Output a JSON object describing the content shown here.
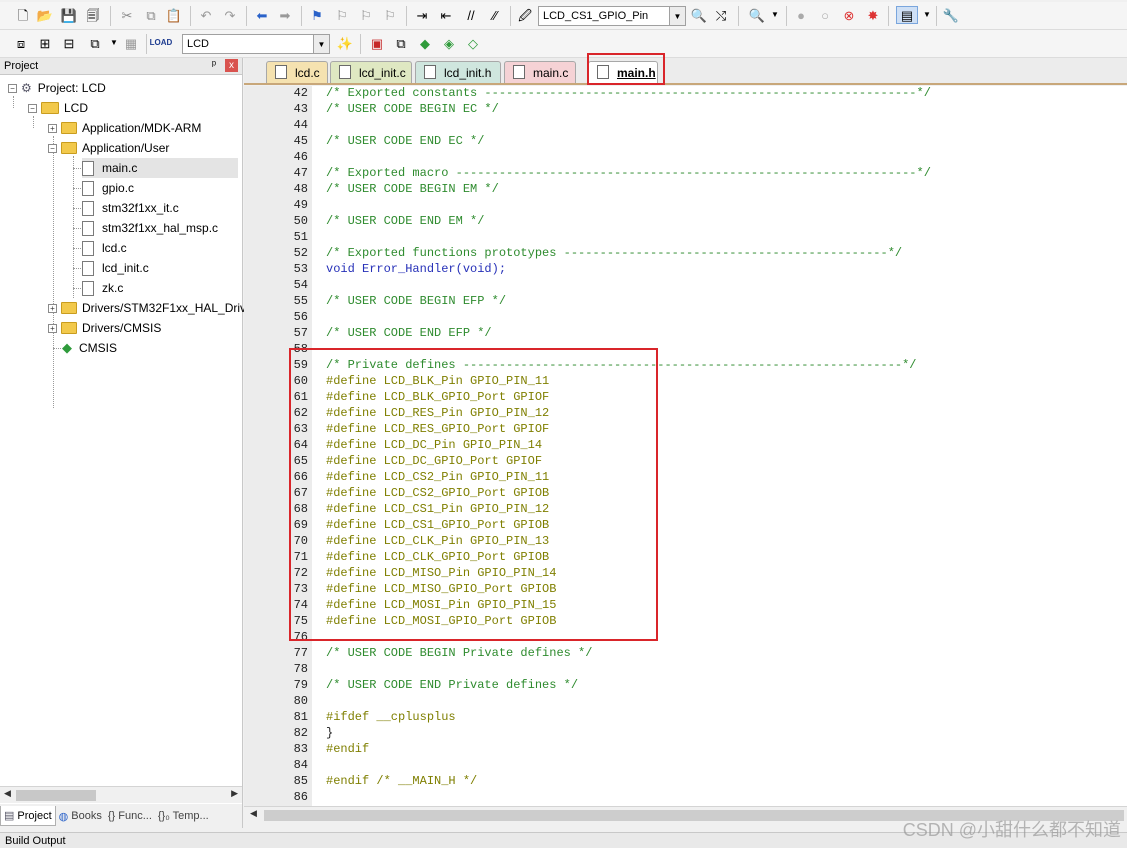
{
  "toolbar1": {
    "target_combo": "LCD_CS1_GPIO_Pin"
  },
  "toolbar2": {
    "target_combo": "LCD"
  },
  "project_panel": {
    "title": "Project",
    "pin": "ᵖ",
    "close": "x",
    "tree": {
      "root": "Project: LCD",
      "target": "LCD",
      "group1": "Application/MDK-ARM",
      "group2": "Application/User",
      "files": [
        "main.c",
        "gpio.c",
        "stm32f1xx_it.c",
        "stm32f1xx_hal_msp.c",
        "lcd.c",
        "lcd_init.c",
        "zk.c"
      ],
      "group3": "Drivers/STM32F1xx_HAL_Driv",
      "group4": "Drivers/CMSIS",
      "cmsis": "CMSIS"
    },
    "bottom_tabs": [
      "Project",
      "Books",
      "{} Func...",
      "{}₀ Temp..."
    ]
  },
  "editor_tabs": [
    "lcd.c",
    "lcd_init.c",
    "lcd_init.h",
    "main.c",
    "main.h"
  ],
  "active_tab": "main.h",
  "code_lines": [
    {
      "n": "42",
      "t": "/* Exported constants ------------------------------------------------------------*/"
    },
    {
      "n": "43",
      "t": "/* USER CODE BEGIN EC */"
    },
    {
      "n": "44",
      "t": ""
    },
    {
      "n": "45",
      "t": "/* USER CODE END EC */"
    },
    {
      "n": "46",
      "t": ""
    },
    {
      "n": "47",
      "t": "/* Exported macro ----------------------------------------------------------------*/"
    },
    {
      "n": "48",
      "t": "/* USER CODE BEGIN EM */"
    },
    {
      "n": "49",
      "t": ""
    },
    {
      "n": "50",
      "t": "/* USER CODE END EM */"
    },
    {
      "n": "51",
      "t": ""
    },
    {
      "n": "52",
      "t": "/* Exported functions prototypes ---------------------------------------------*/"
    },
    {
      "n": "53",
      "t": "void Error_Handler(void);"
    },
    {
      "n": "54",
      "t": ""
    },
    {
      "n": "55",
      "t": "/* USER CODE BEGIN EFP */"
    },
    {
      "n": "56",
      "t": ""
    },
    {
      "n": "57",
      "t": "/* USER CODE END EFP */"
    },
    {
      "n": "58",
      "t": ""
    },
    {
      "n": "59",
      "t": "/* Private defines -------------------------------------------------------------*/"
    },
    {
      "n": "60",
      "t": "#define LCD_BLK_Pin GPIO_PIN_11"
    },
    {
      "n": "61",
      "t": "#define LCD_BLK_GPIO_Port GPIOF"
    },
    {
      "n": "62",
      "t": "#define LCD_RES_Pin GPIO_PIN_12"
    },
    {
      "n": "63",
      "t": "#define LCD_RES_GPIO_Port GPIOF"
    },
    {
      "n": "64",
      "t": "#define LCD_DC_Pin GPIO_PIN_14"
    },
    {
      "n": "65",
      "t": "#define LCD_DC_GPIO_Port GPIOF"
    },
    {
      "n": "66",
      "t": "#define LCD_CS2_Pin GPIO_PIN_11"
    },
    {
      "n": "67",
      "t": "#define LCD_CS2_GPIO_Port GPIOB"
    },
    {
      "n": "68",
      "t": "#define LCD_CS1_Pin GPIO_PIN_12"
    },
    {
      "n": "69",
      "t": "#define LCD_CS1_GPIO_Port GPIOB"
    },
    {
      "n": "70",
      "t": "#define LCD_CLK_Pin GPIO_PIN_13"
    },
    {
      "n": "71",
      "t": "#define LCD_CLK_GPIO_Port GPIOB"
    },
    {
      "n": "72",
      "t": "#define LCD_MISO_Pin GPIO_PIN_14"
    },
    {
      "n": "73",
      "t": "#define LCD_MISO_GPIO_Port GPIOB"
    },
    {
      "n": "74",
      "t": "#define LCD_MOSI_Pin GPIO_PIN_15"
    },
    {
      "n": "75",
      "t": "#define LCD_MOSI_GPIO_Port GPIOB"
    },
    {
      "n": "76",
      "t": ""
    },
    {
      "n": "77",
      "t": "/* USER CODE BEGIN Private defines */"
    },
    {
      "n": "78",
      "t": ""
    },
    {
      "n": "79",
      "t": "/* USER CODE END Private defines */"
    },
    {
      "n": "80",
      "t": ""
    },
    {
      "n": "81",
      "t": "#ifdef __cplusplus"
    },
    {
      "n": "82",
      "t": "}"
    },
    {
      "n": "83",
      "t": "#endif"
    },
    {
      "n": "84",
      "t": ""
    },
    {
      "n": "85",
      "t": "#endif /* __MAIN_H */"
    },
    {
      "n": "86",
      "t": ""
    }
  ],
  "build_output": "Build Output",
  "watermark": "CSDN @小甜什么都不知道",
  "colors": {
    "comment": "#2e8b2e",
    "keyword": "#2630b8",
    "preprocessor": "#7f7f00",
    "highlight_box": "#d9252a"
  }
}
